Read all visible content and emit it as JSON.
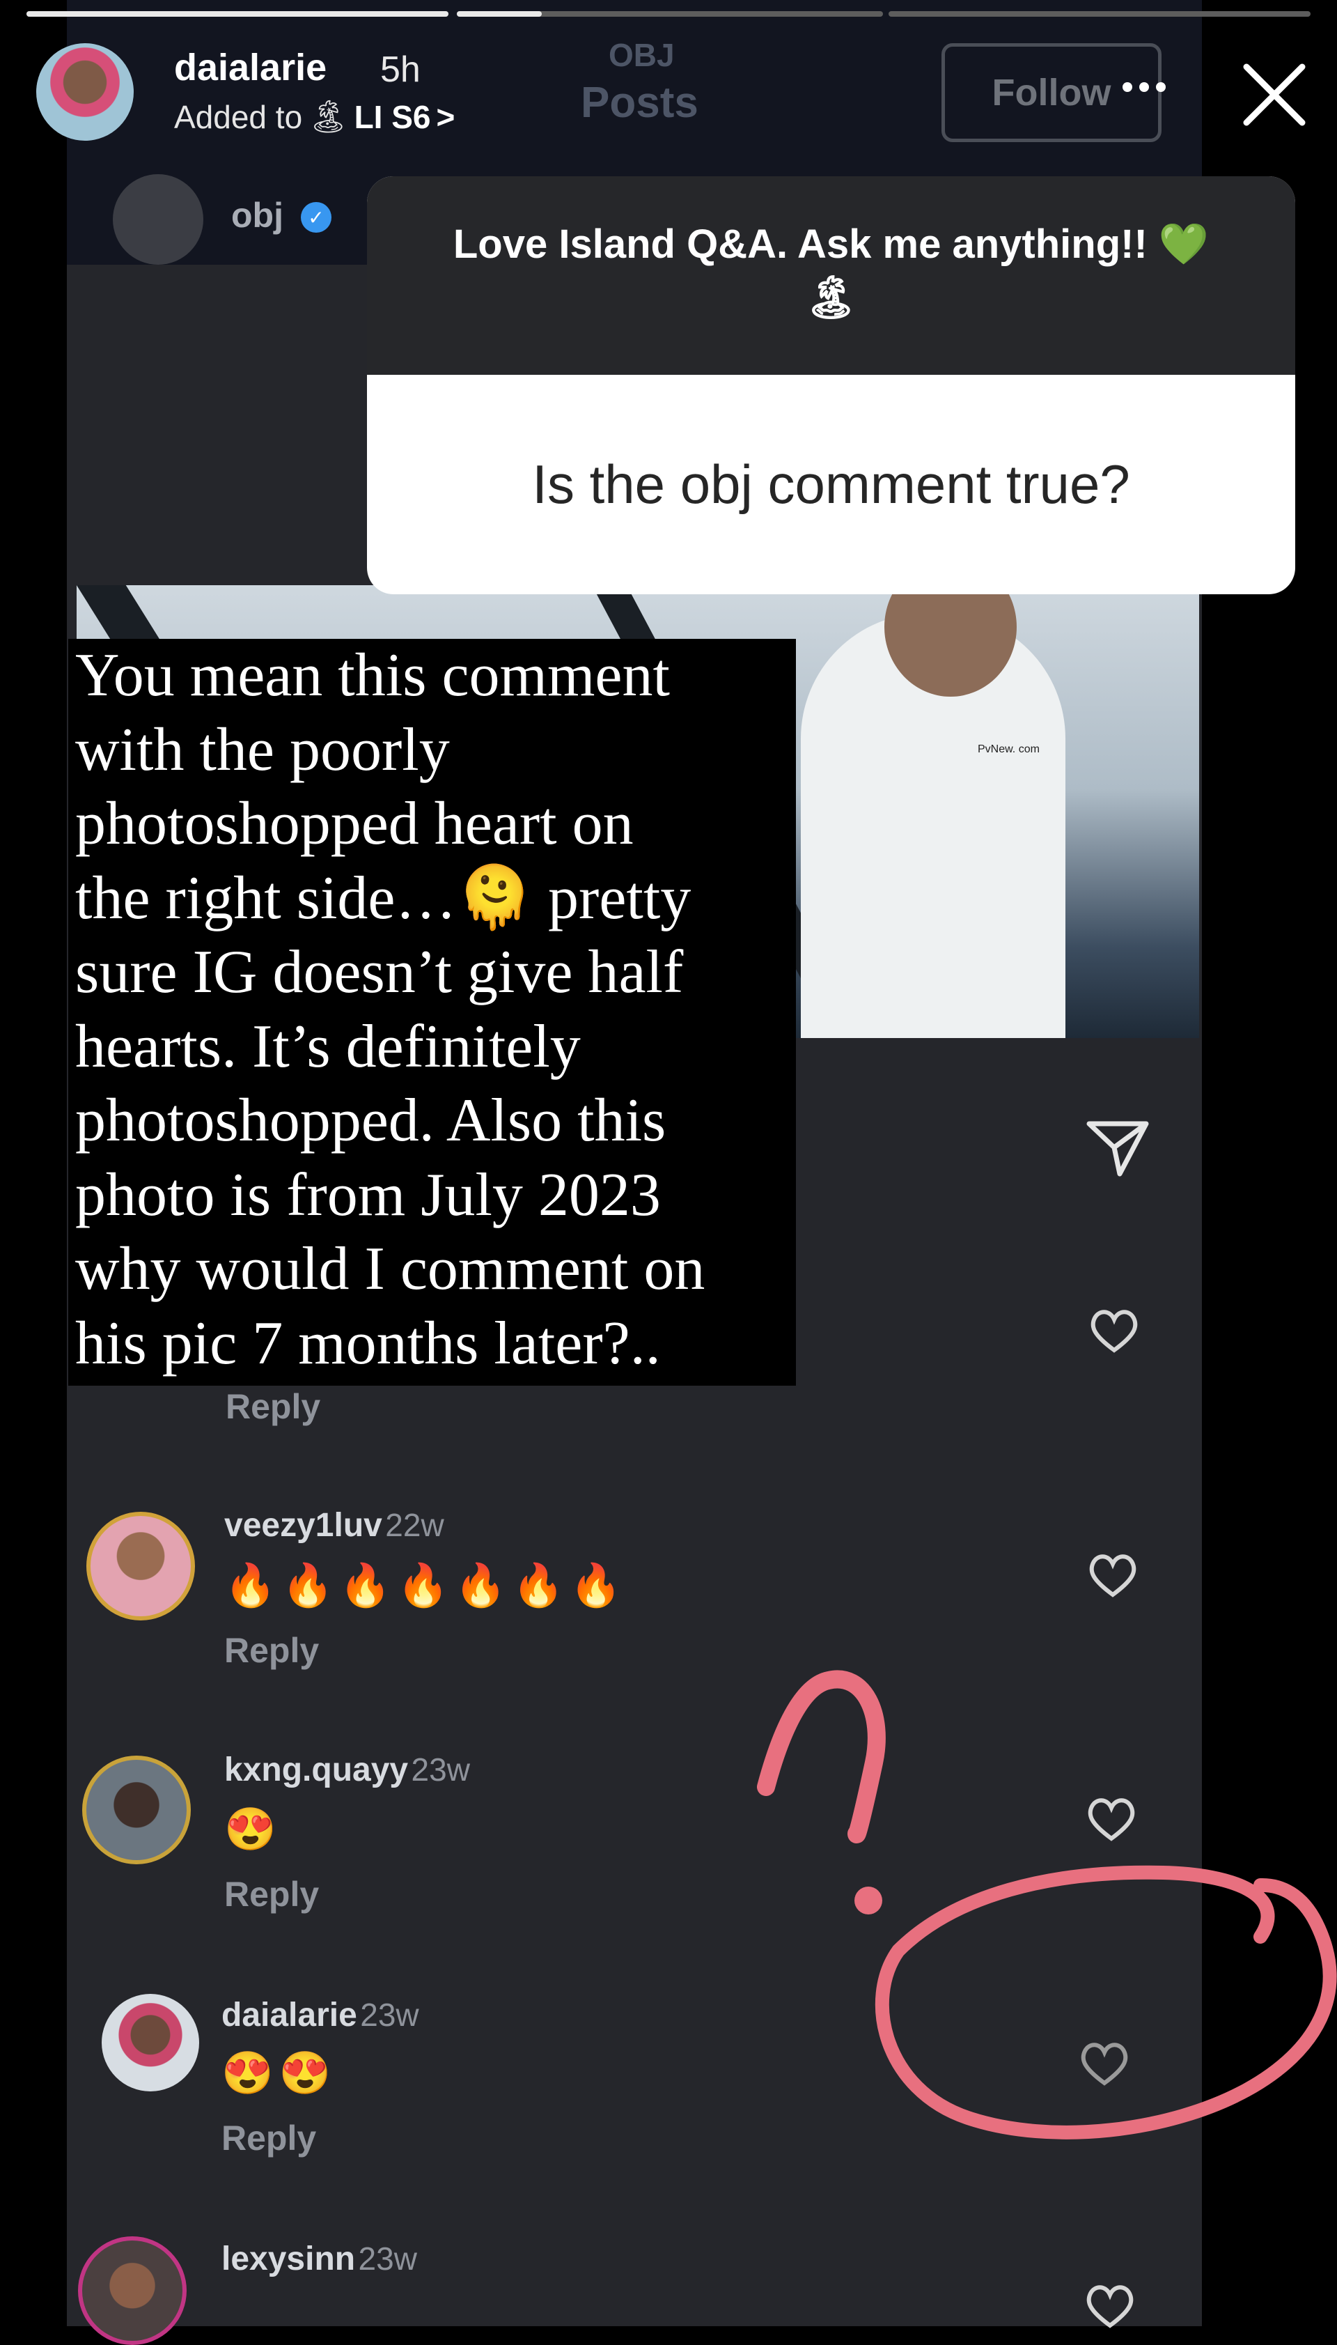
{
  "progress": [
    1.0,
    0.2,
    0.0
  ],
  "story": {
    "username": "daialarie",
    "time": "5h",
    "added_prefix": "Added to",
    "highlight_emoji": "🏝",
    "highlight_name": "LI S6",
    "chevron": ">"
  },
  "background_post": {
    "title_small": "OBJ",
    "title": "Posts",
    "follow_label": "Follow",
    "username": "obj"
  },
  "sticker": {
    "prompt": "Love Island Q&A. Ask me anything!! 💚",
    "prompt_emoji": "🏝",
    "question": "Is the obj comment true?"
  },
  "answer_text": "You mean this comment\nwith the poorly\nphotoshopped heart on\nthe right side…🫠 pretty\nsure IG doesn’t give half\nhearts. It’s definitely\nphotoshopped. Also this\nphoto is from July 2023\nwhy would I comment on\nhis pic 7 months later?..",
  "watermark": "PvNew. com",
  "comments": [
    {
      "username": "veezy1luv",
      "age": "22w",
      "text": "🔥🔥🔥🔥🔥🔥🔥",
      "reply": "Reply"
    },
    {
      "username": "kxng.quayy",
      "age": "23w",
      "text": "😍",
      "reply": "Reply"
    },
    {
      "username": "daialarie",
      "age": "23w",
      "text": "😍😍",
      "reply": "Reply"
    },
    {
      "username": "lexysinn",
      "age": "23w",
      "text": "",
      "reply": ""
    }
  ],
  "first_reply": "Reply",
  "annotation": {
    "mark": "?"
  }
}
